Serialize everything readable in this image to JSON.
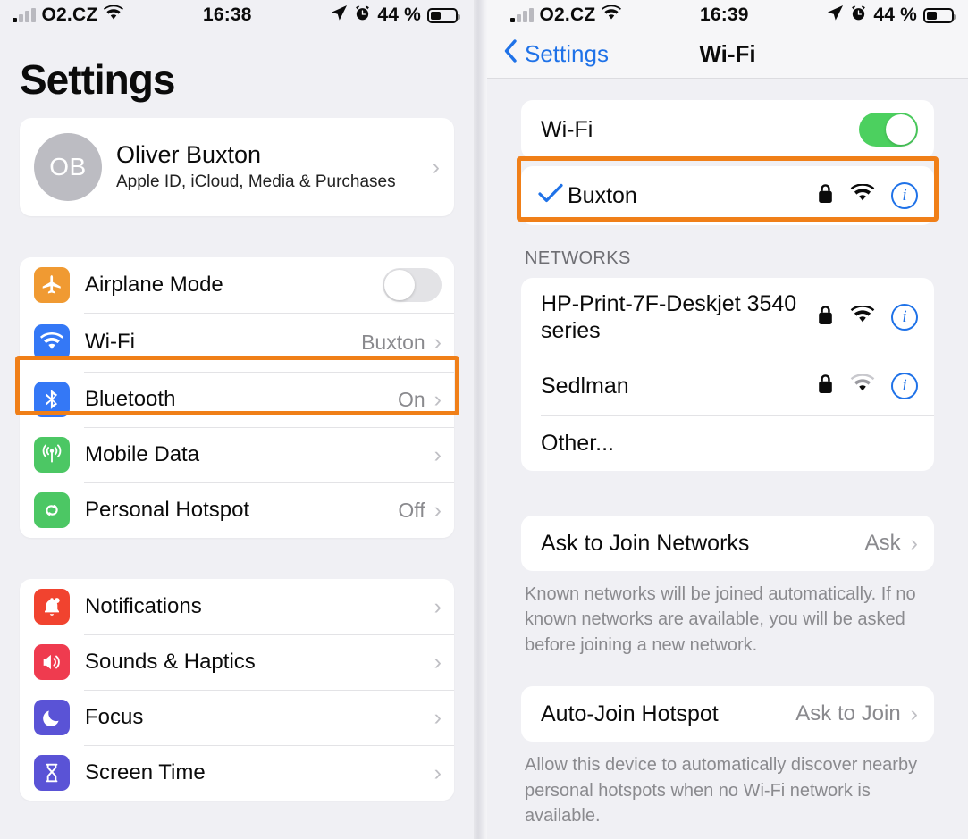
{
  "colors": {
    "accent_blue": "#1f72e8",
    "highlight_orange": "#f07f18",
    "toggle_green": "#4cd05f",
    "page_bg": "#f0f0f4",
    "card_bg": "#ffffff",
    "secondary_text": "#8a8a8e"
  },
  "left_panel": {
    "status_bar": {
      "carrier": "O2.CZ",
      "signal_icon": "cellular-bars-icon",
      "wifi_icon": "wifi-icon",
      "time": "16:38",
      "location_icon": "location-arrow-icon",
      "alarm_icon": "alarm-clock-icon",
      "battery_percent": "44 %",
      "battery_icon": "battery-icon",
      "battery_level": 44
    },
    "page_title": "Settings",
    "account": {
      "initials": "OB",
      "name": "Oliver Buxton",
      "subtitle": "Apple ID, iCloud, Media & Purchases",
      "chevron": "›"
    },
    "group_connectivity": [
      {
        "label": "Airplane Mode",
        "icon": "airplane-icon",
        "icon_color": "#f09a32",
        "control": "toggle",
        "toggle_on": false
      },
      {
        "label": "Wi-Fi",
        "icon": "wifi-icon",
        "icon_color": "#3478f6",
        "value": "Buxton",
        "control": "chevron",
        "highlighted": true
      },
      {
        "label": "Bluetooth",
        "icon": "bluetooth-icon",
        "icon_color": "#3478f6",
        "value": "On",
        "control": "chevron"
      },
      {
        "label": "Mobile Data",
        "icon": "cellular-antenna-icon",
        "icon_color": "#4cc764",
        "value": "",
        "control": "chevron"
      },
      {
        "label": "Personal Hotspot",
        "icon": "hotspot-link-icon",
        "icon_color": "#4cc764",
        "value": "Off",
        "control": "chevron"
      }
    ],
    "group_system": [
      {
        "label": "Notifications",
        "icon": "bell-icon",
        "icon_color": "#f1432f",
        "control": "chevron"
      },
      {
        "label": "Sounds & Haptics",
        "icon": "speaker-icon",
        "icon_color": "#ef3b4f",
        "control": "chevron"
      },
      {
        "label": "Focus",
        "icon": "moon-icon",
        "icon_color": "#5a53d6",
        "control": "chevron"
      },
      {
        "label": "Screen Time",
        "icon": "hourglass-icon",
        "icon_color": "#5a53d6",
        "control": "chevron"
      }
    ]
  },
  "right_panel": {
    "status_bar": {
      "carrier": "O2.CZ",
      "signal_icon": "cellular-bars-icon",
      "wifi_icon": "wifi-icon",
      "time": "16:39",
      "location_icon": "location-arrow-icon",
      "alarm_icon": "alarm-clock-icon",
      "battery_percent": "44 %",
      "battery_icon": "battery-icon",
      "battery_level": 44
    },
    "nav": {
      "back_label": "Settings",
      "back_icon": "chevron-left-icon",
      "title": "Wi-Fi"
    },
    "wifi_toggle": {
      "label": "Wi-Fi",
      "toggle_on": true
    },
    "connected_network": {
      "name": "Buxton",
      "check_icon": "checkmark-icon",
      "lock_icon": "lock-icon",
      "signal_icon": "wifi-icon",
      "info_icon": "info-circle-icon",
      "highlighted": true
    },
    "networks_header": "NETWORKS",
    "networks": [
      {
        "name": "HP-Print-7F-Deskjet 3540 series",
        "lock_icon": "lock-icon",
        "signal_icon": "wifi-icon",
        "signal_strength": "strong",
        "info_icon": "info-circle-icon"
      },
      {
        "name": "Sedlman",
        "lock_icon": "lock-icon",
        "signal_icon": "wifi-icon",
        "signal_strength": "weak",
        "info_icon": "info-circle-icon"
      },
      {
        "name": "Other...",
        "lock_icon": "",
        "signal_icon": "",
        "info_icon": ""
      }
    ],
    "ask_to_join": {
      "label": "Ask to Join Networks",
      "value": "Ask",
      "chevron": "›",
      "footnote": "Known networks will be joined automatically. If no known networks are available, you will be asked before joining a new network."
    },
    "auto_join_hotspot": {
      "label": "Auto-Join Hotspot",
      "value": "Ask to Join",
      "chevron": "›",
      "footnote": "Allow this device to automatically discover nearby personal hotspots when no Wi-Fi network is available."
    }
  }
}
